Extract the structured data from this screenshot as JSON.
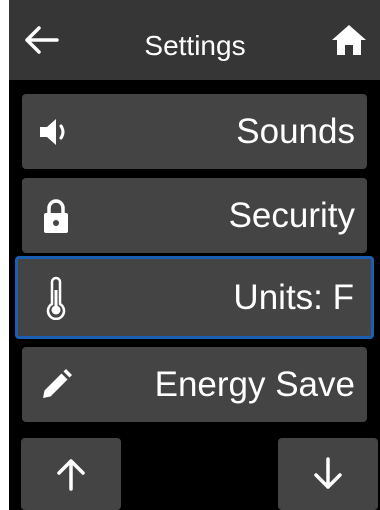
{
  "header": {
    "title": "Settings",
    "back_icon": "arrow-left-icon",
    "home_icon": "home-icon"
  },
  "menu": {
    "items": [
      {
        "label": "Sounds",
        "icon": "speaker-icon"
      },
      {
        "label": "Security",
        "icon": "lock-icon"
      },
      {
        "label": "Units: F",
        "icon": "thermometer-icon",
        "selected": true
      },
      {
        "label": "Energy Save",
        "icon": "pencil-icon"
      }
    ]
  },
  "nav": {
    "up_icon": "arrow-up-icon",
    "down_icon": "arrow-down-icon"
  },
  "colors": {
    "background": "#000000",
    "header": "#363636",
    "button": "#444444",
    "selected_border": "#1a5fb4",
    "text": "#ffffff"
  }
}
